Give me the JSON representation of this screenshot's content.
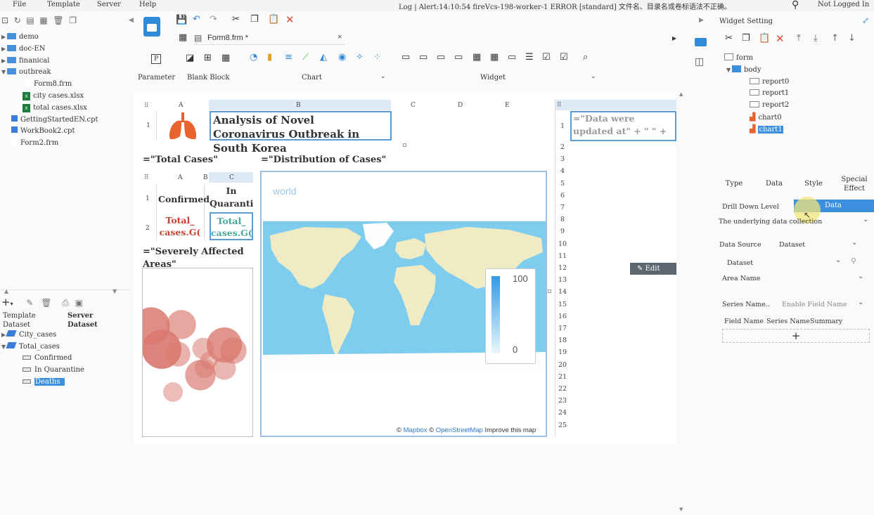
{
  "menu": {
    "file": "File",
    "template": "Template",
    "server": "Server",
    "help": "Help"
  },
  "status": {
    "log": "Log | Alert:14:10:54 fireVcs-198-worker-1 ERROR [standard] 文件名、目录名或卷标语法不正确。",
    "user": "Not Logged In"
  },
  "file_tree": {
    "items": [
      {
        "label": "demo",
        "kind": "folder"
      },
      {
        "label": "doc-EN",
        "kind": "folder"
      },
      {
        "label": "finanical",
        "kind": "folder"
      },
      {
        "label": "outbreak",
        "kind": "folder"
      },
      {
        "label": "Form8.frm",
        "kind": "doc"
      },
      {
        "label": "city cases.xlsx",
        "kind": "xls"
      },
      {
        "label": "total cases.xlsx",
        "kind": "xls"
      },
      {
        "label": "GettingStartedEN.cpt",
        "kind": "cpt"
      },
      {
        "label": "WorkBook2.cpt",
        "kind": "cpt"
      },
      {
        "label": "Form2.frm",
        "kind": "doc"
      }
    ]
  },
  "dataset_panel": {
    "template_label": "Template Dataset",
    "server_label": "Server Dataset",
    "items": [
      {
        "label": "City_cases"
      },
      {
        "label": "Total_cases"
      },
      {
        "label": "Confirmed"
      },
      {
        "label": "In Quarantine"
      },
      {
        "label": "Deaths"
      }
    ]
  },
  "editor": {
    "tab_title": "Form8.frm *",
    "categories": {
      "parameter": "Parameter",
      "blank_block": "Blank Block",
      "chart": "Chart",
      "widget": "Widget"
    }
  },
  "canvas": {
    "cols": [
      "A",
      "B",
      "C",
      "D",
      "E"
    ],
    "title_text": "Analysis of Novel Coronavirus Outbreak in South Korea",
    "total_cases_label": "=\"Total Cases\"",
    "distribution_label": "=\"Distribution of Cases\"",
    "severe_label": "=\"Severely Affected Areas\"",
    "small_cols": [
      "A",
      "B",
      "C"
    ],
    "confirmed_header": "Confirmed",
    "quarantine_header": "In Quarantin",
    "total_cases_formula_1": "Total_ cases.G(",
    "total_cases_formula_2": "Total_ cases.G(",
    "map": {
      "title": "world",
      "legend_max": "100",
      "legend_min": "0",
      "attribution_prefix": "© ",
      "mapbox": "Mapbox",
      "osm_prefix": " © ",
      "osm": "OpenStreetMap",
      "improve": " Improve this map"
    },
    "bubbles": [
      0.9,
      0.55,
      0.4,
      1.0,
      0.3,
      0.25,
      0.35,
      0.2,
      0.6,
      0.8,
      0.45,
      0.25
    ]
  },
  "sheet2": {
    "formula": "=\"Data were updated at\" + \" \" + if(format(nov",
    "rows": [
      "1",
      "2",
      "3",
      "4",
      "5",
      "6",
      "7",
      "8",
      "9",
      "10",
      "11",
      "12",
      "13",
      "14",
      "15",
      "16",
      "17",
      "18",
      "19",
      "20",
      "21",
      "22",
      "23",
      "24",
      "25"
    ],
    "edit_button": "Edit"
  },
  "right_panel": {
    "title": "Widget Setting",
    "tree": [
      {
        "label": "form"
      },
      {
        "label": "body"
      },
      {
        "label": "report0"
      },
      {
        "label": "report1"
      },
      {
        "label": "report2"
      },
      {
        "label": "chart0"
      },
      {
        "label": "chart1"
      }
    ],
    "tabs": {
      "type": "Type",
      "data": "Data",
      "style": "Style",
      "special": "Special Effect"
    },
    "drill_down_label": "Drill Down Level",
    "drill_down_value": "Data",
    "underlying_label": "The underlying data collection",
    "data_source_label": "Data Source",
    "data_source_value": "Dataset",
    "dataset_label": "Dataset",
    "area_name_label": "Area Name",
    "series_name_label": "Series Name..",
    "series_name_value": "Enable Field Name",
    "field_name": "Field Name",
    "series_name": "Series Name",
    "summary": "Summary",
    "add": "+"
  },
  "colors": {
    "accent": "#3d8fe0",
    "selected_bg": "#3d8fe0",
    "title_formula": "#c8432f",
    "map_water": "#7fcdee",
    "map_land": "#efebc4",
    "bubble": "#d9786e"
  }
}
